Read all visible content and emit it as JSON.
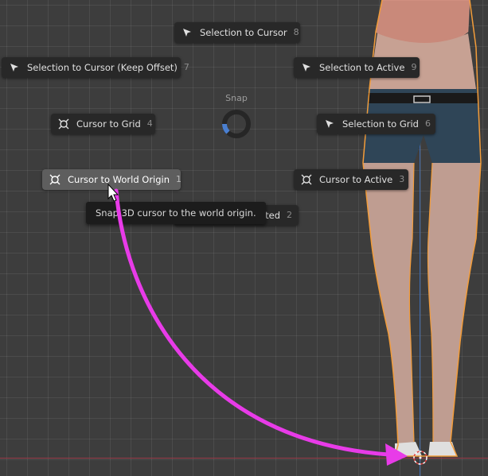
{
  "pie_menu": {
    "title": "Snap",
    "items": [
      {
        "id": "selection-to-cursor",
        "label": "Selection to Cursor",
        "key": "8",
        "icon": "cursor-arrow-icon"
      },
      {
        "id": "selection-to-cursor-keep-offset",
        "label": "Selection to Cursor (Keep Offset)",
        "key": "7",
        "icon": "cursor-arrow-icon"
      },
      {
        "id": "selection-to-active",
        "label": "Selection to Active",
        "key": "9",
        "icon": "cursor-arrow-icon"
      },
      {
        "id": "cursor-to-grid",
        "label": "Cursor to Grid",
        "key": "4",
        "icon": "3d-cursor-icon"
      },
      {
        "id": "selection-to-grid",
        "label": "Selection to Grid",
        "key": "6",
        "icon": "cursor-arrow-icon"
      },
      {
        "id": "cursor-to-world-origin",
        "label": "Cursor to World Origin",
        "key": "1",
        "icon": "3d-cursor-icon",
        "highlighted": true
      },
      {
        "id": "cursor-to-active",
        "label": "Cursor to Active",
        "key": "3",
        "icon": "3d-cursor-icon"
      },
      {
        "id": "cursor-to-selected",
        "label": "elected",
        "key": "2",
        "icon": "3d-cursor-icon"
      }
    ]
  },
  "tooltip": {
    "text": "Snap 3D cursor to the world origin."
  },
  "colors": {
    "accent_arrow": "#e83be8",
    "pie_indicator": "#4a7fd0",
    "outline": "#f29c3a"
  }
}
